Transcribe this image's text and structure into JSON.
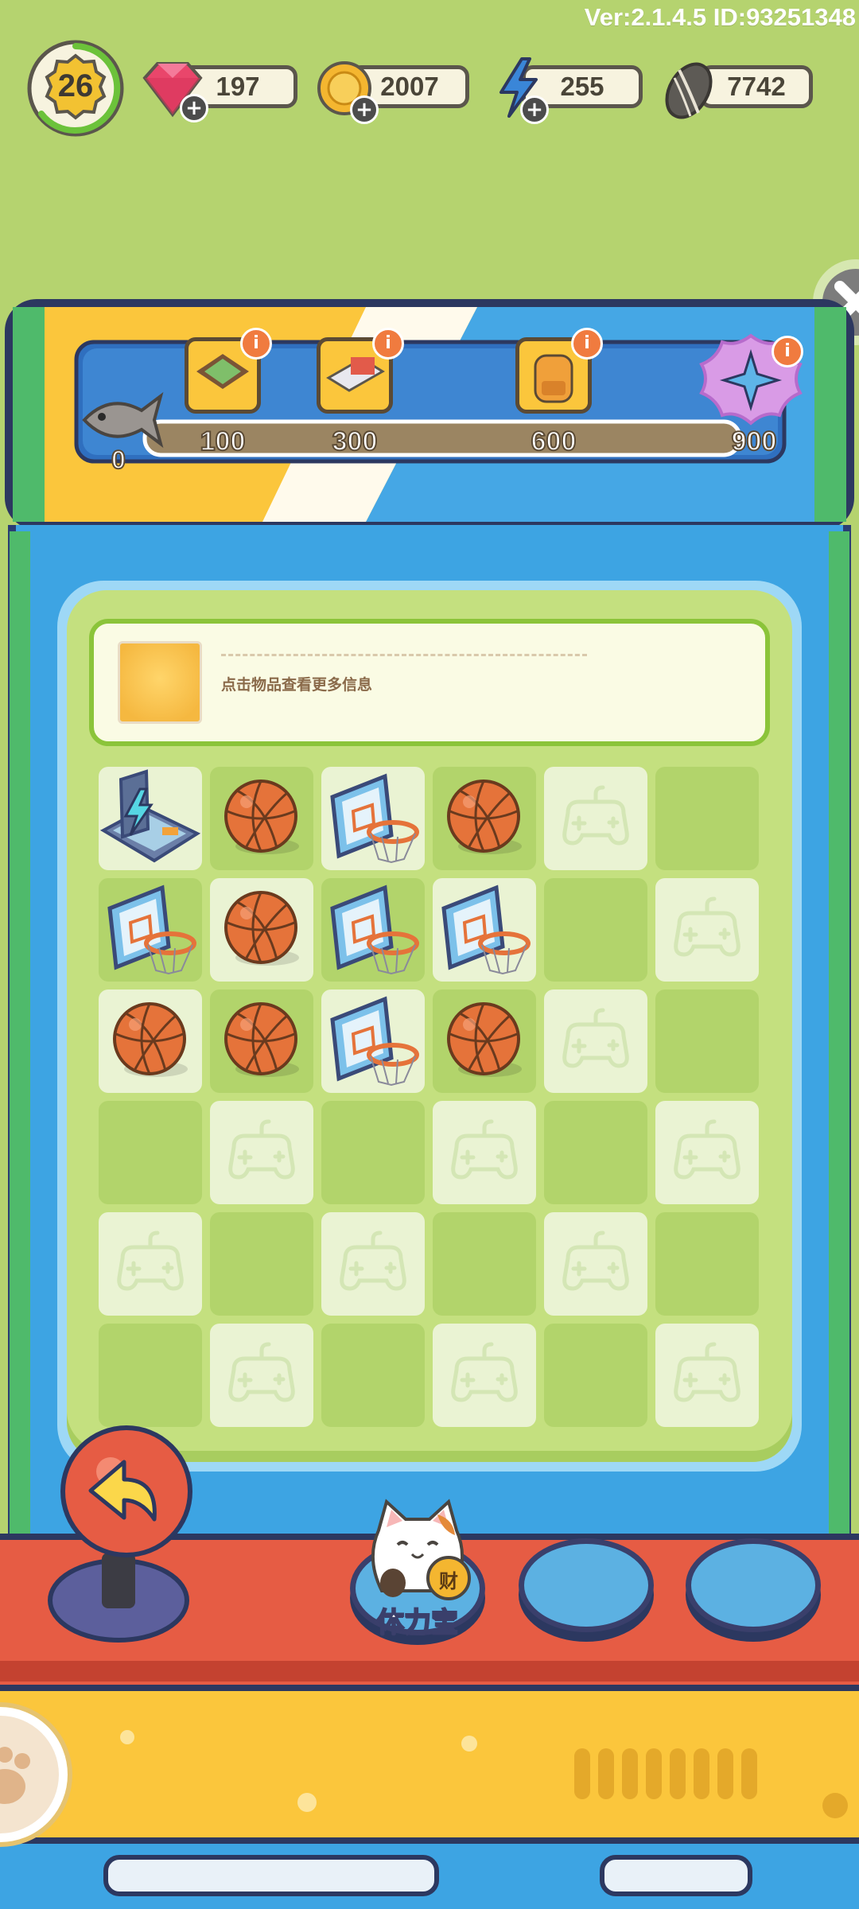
{
  "version": "Ver:2.1.4.5 ID:93251348",
  "hud": {
    "level": "26",
    "gems": "197",
    "coins": "2007",
    "energy": "255",
    "seeds": "7742"
  },
  "reward_track": {
    "current": "0",
    "milestones": [
      {
        "value": "100",
        "icon": "board-game-icon"
      },
      {
        "value": "300",
        "icon": "console-icon"
      },
      {
        "value": "600",
        "icon": "backpack-icon"
      },
      {
        "value": "900",
        "icon": "shuriken-icon"
      }
    ],
    "info_badge": "i"
  },
  "info_panel": {
    "hint": "点击物品查看更多信息"
  },
  "grid": {
    "rows": [
      [
        "energy-generator",
        "basketball",
        "hoop",
        "basketball",
        "empty",
        "empty"
      ],
      [
        "hoop",
        "basketball",
        "hoop",
        "hoop",
        "empty",
        "empty"
      ],
      [
        "basketball",
        "basketball",
        "hoop",
        "basketball",
        "empty",
        "empty"
      ],
      [
        "empty",
        "empty",
        "empty",
        "empty",
        "empty",
        "empty"
      ],
      [
        "empty",
        "empty",
        "empty",
        "empty",
        "empty",
        "empty"
      ],
      [
        "empty",
        "empty",
        "empty",
        "empty",
        "empty",
        "empty"
      ]
    ]
  },
  "controls": {
    "stamina_label": "体力宝",
    "lucky_badge": "财"
  },
  "colors": {
    "background": "#b5d36f",
    "machine_blue": "#3da4e3",
    "console_red": "#e65c44",
    "console_yellow": "#fbc63c",
    "outline": "#2c3860"
  }
}
